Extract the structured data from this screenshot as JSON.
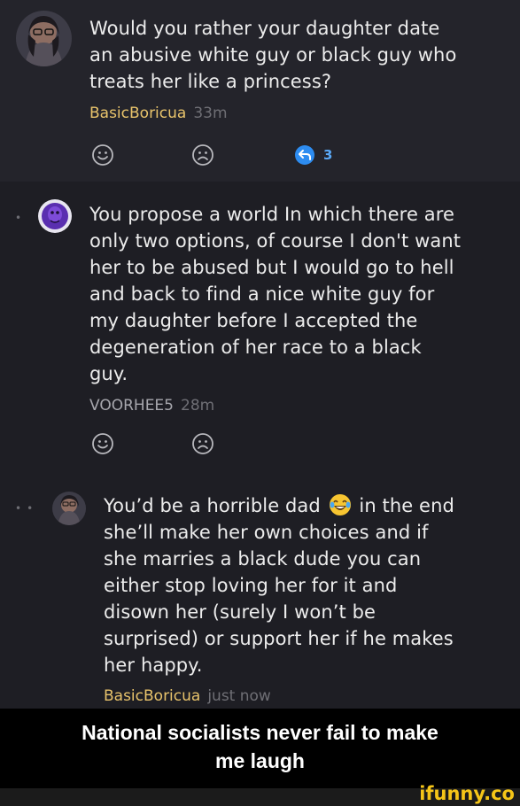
{
  "comments": [
    {
      "author": "BasicBoricua",
      "time": "33m",
      "lines": [
        "Would you rather your daughter date",
        "an abusive white guy or black guy who",
        "treats her like a princess?"
      ],
      "reply_count": "3"
    },
    {
      "author": "VOORHEE5",
      "time": "28m",
      "lines": [
        "You propose a world In which there are",
        "only two options, of course I don't want",
        "her to be abused but I would go to hell",
        "and back to find a nice white guy for",
        "my daughter before I accepted the",
        "degeneration of her race to a black",
        "guy."
      ]
    },
    {
      "author": "BasicBoricua",
      "time": "just now",
      "lines": [
        "You’d be a horrible dad",
        "she’ll make her own choices and if",
        "she marries a black dude you can",
        "either stop loving her for it and",
        "disown her (surely I won’t be",
        "surprised) or support her if he makes",
        "her happy."
      ],
      "line1_suffix": "in the end"
    }
  ],
  "caption": [
    "National socialists never fail to make",
    "me laugh"
  ],
  "watermark": "ifunny.co",
  "colors": {
    "author_accent": "#e8c36b",
    "reply_blue": "#2d8cf0"
  },
  "icons": [
    "smile-icon",
    "frown-icon",
    "reply-icon",
    "laughing-emoji-icon"
  ]
}
